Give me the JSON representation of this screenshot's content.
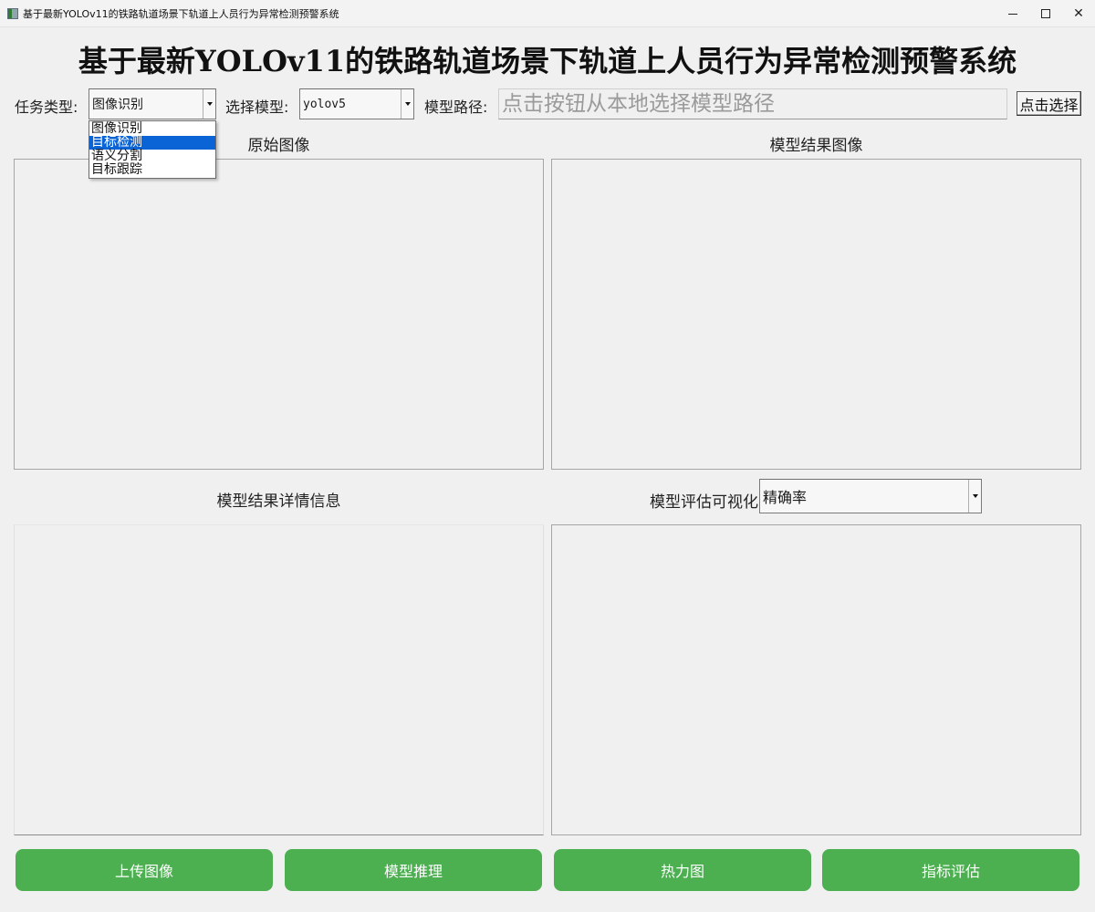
{
  "window": {
    "title": "基于最新YOLOv11的铁路轨道场景下轨道上人员行为异常检测预警系统",
    "controls": {
      "minimize": "—",
      "maximize": "☐",
      "close": "✕"
    }
  },
  "header": {
    "title": "基于最新YOLOv11的铁路轨道场景下轨道上人员行为异常检测预警系统"
  },
  "toolbar": {
    "task_label": "任务类型:",
    "task_value": "图像识别",
    "task_options": [
      "图像识别",
      "目标检测",
      "语义分割",
      "目标跟踪"
    ],
    "task_highlighted": "目标检测",
    "model_label": "选择模型:",
    "model_value": "yolov5",
    "path_label": "模型路径:",
    "path_placeholder": "点击按钮从本地选择模型路径",
    "choose_button": "点击选择"
  },
  "panels": {
    "original_title": "原始图像",
    "result_title": "模型结果图像",
    "details_title": "模型结果详情信息",
    "eval_title": "模型评估可视化",
    "eval_metric_value": "精确率"
  },
  "actions": {
    "upload": "上传图像",
    "infer": "模型推理",
    "heatmap": "热力图",
    "evaluate": "指标评估"
  },
  "colors": {
    "accent_green": "#4caf50",
    "selection_blue": "#0a64d6"
  }
}
